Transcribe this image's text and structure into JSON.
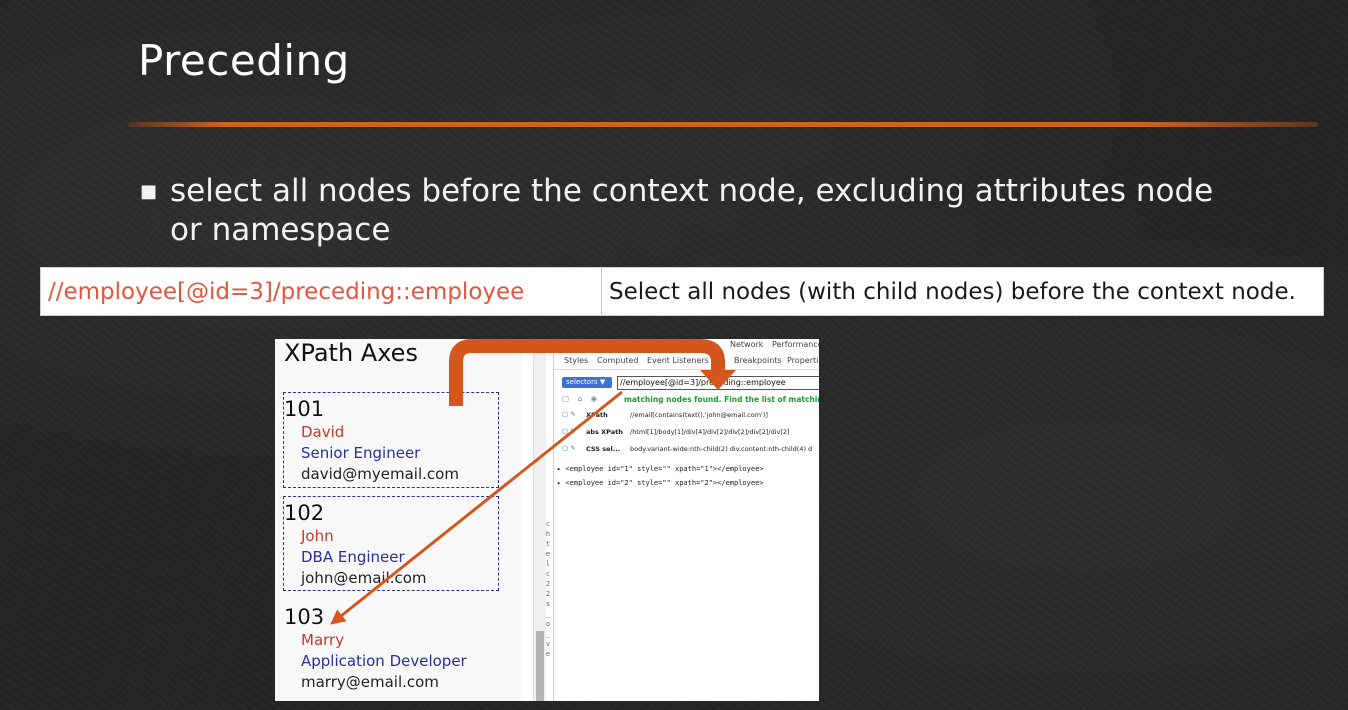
{
  "slide": {
    "title": "Preceding",
    "bullet": "select all nodes before the context node, excluding attributes node or namespace"
  },
  "table": {
    "expression": "//employee[@id=3]/preceding::employee",
    "description": "Select all nodes (with child nodes) before the context node."
  },
  "screenshot": {
    "heading": "XPath Axes",
    "employees": [
      {
        "id": "101",
        "name": "David",
        "role": "Senior Engineer",
        "email": "david@myemail.com"
      },
      {
        "id": "102",
        "name": "John",
        "role": "DBA Engineer",
        "email": "john@email.com"
      },
      {
        "id": "103",
        "name": "Marry",
        "role": "Application Developer",
        "email": "marry@email.com"
      }
    ],
    "vertical_text": "chtel c22s_o_ve",
    "devtools": {
      "top_tabs": [
        "Network",
        "Performance"
      ],
      "tabs": [
        "Styles",
        "Computed",
        "Event Listeners",
        "Breakpoints",
        "Propertie"
      ],
      "selector_badge": "selectors ▼",
      "query": "//employee[@id=3]/preceding::employee",
      "match_icons": "▢ ⌂ ◉",
      "match_message": "matching nodes found. Find the list of matching nodes",
      "rows": [
        {
          "label": "XPath",
          "value": "//email[contains(text(),'john@email.com')]"
        },
        {
          "label": "abs XPath",
          "value": "/html[1]/body[1]/div[4]/div[2]/div[2]/div[2]/div[2]"
        },
        {
          "label": "CSS sel...",
          "value": "body.variant-wide:nth-child(2) div.content:nth-child(4) d"
        }
      ],
      "results": [
        "▸ <employee id=\"1\" style=\"\" xpath=\"1\"></employee>",
        "▸ <employee id=\"2\" style=\"\" xpath=\"2\"></employee>"
      ]
    }
  },
  "colors": {
    "accent": "#d4621d",
    "expression_red": "#e2553f",
    "arrow": "#d4561c",
    "dashed_box": "#2b2f9c"
  }
}
